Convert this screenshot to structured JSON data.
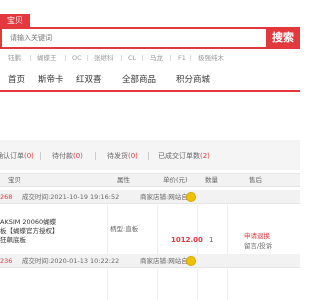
{
  "search": {
    "tab": "宝贝",
    "placeholder": "请输入关键词",
    "button": "搜索",
    "hot_words": [
      "钰鹏",
      "蝴蝶王",
      "OC",
      "张继科",
      "CL",
      "马龙",
      "F1",
      "极强纯木"
    ]
  },
  "nav": {
    "items": [
      "首页",
      "斯帝卡",
      "红双喜",
      "全部商品",
      "积分商城"
    ]
  },
  "status_bar": {
    "items": [
      {
        "label": "确认订单",
        "count": "(0)"
      },
      {
        "label": "待付款",
        "count": "(0)"
      },
      {
        "label": "待发货",
        "count": "(0)"
      },
      {
        "label": "已成交订单数",
        "count": "(2)"
      }
    ]
  },
  "table": {
    "headers": [
      "宝贝",
      "属性",
      "单价(元)",
      "数量",
      "售后"
    ]
  },
  "orders": [
    {
      "id": "268",
      "time_label": "成交时间:",
      "time": "2021-10-19 19:16:52",
      "shop_label": "商家店铺:",
      "shop": "网站自营",
      "product_lines": [
        "AKSIM 20060蝴蝶",
        "板【蝴蝶官方授权】",
        "狂飙底板"
      ],
      "attribute": "柄型:直板",
      "price": "1012.00",
      "quantity": "1",
      "after_sale": "申请退换",
      "after_sale_sub": "留言/投诉"
    },
    {
      "id": "236",
      "time_label": "成交时间:",
      "time": "2020-01-13 10:22:22",
      "shop_label": "商家店铺:",
      "shop": "网站自营"
    }
  ],
  "colors": {
    "accent": "#e4393c",
    "shop_icon": "#f2c200"
  }
}
